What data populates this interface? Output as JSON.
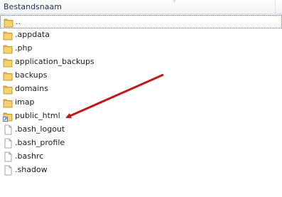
{
  "header": {
    "name_column": "Bestandsnaam"
  },
  "files": [
    {
      "name": "..",
      "type": "folder",
      "selected": true
    },
    {
      "name": ".appdata",
      "type": "folder"
    },
    {
      "name": ".php",
      "type": "folder"
    },
    {
      "name": "application_backups",
      "type": "folder"
    },
    {
      "name": "backups",
      "type": "folder"
    },
    {
      "name": "domains",
      "type": "folder"
    },
    {
      "name": "imap",
      "type": "folder"
    },
    {
      "name": "public_html",
      "type": "folder-shortcut"
    },
    {
      "name": ".bash_logout",
      "type": "file"
    },
    {
      "name": ".bash_profile",
      "type": "file"
    },
    {
      "name": ".bashrc",
      "type": "file"
    },
    {
      "name": ".shadow",
      "type": "file"
    }
  ],
  "annotation": {
    "color": "#c0191c"
  }
}
